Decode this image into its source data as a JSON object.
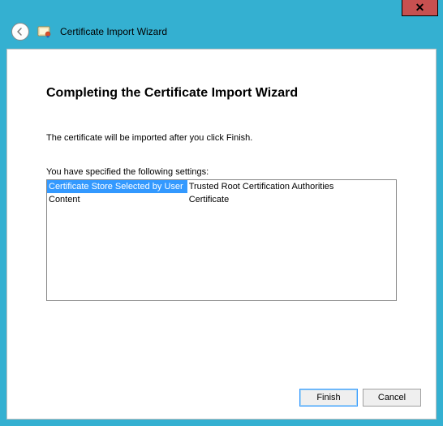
{
  "window": {
    "close_glyph": "✕"
  },
  "header": {
    "title": "Certificate Import Wizard"
  },
  "main": {
    "heading": "Completing the Certificate Import Wizard",
    "subtext": "The certificate will be imported after you click Finish.",
    "settings_label": "You have specified the following settings:",
    "rows": [
      {
        "key": "Certificate Store Selected by User",
        "value": "Trusted Root Certification Authorities",
        "selected": true
      },
      {
        "key": "Content",
        "value": "Certificate",
        "selected": false
      }
    ]
  },
  "footer": {
    "finish": "Finish",
    "cancel": "Cancel"
  }
}
